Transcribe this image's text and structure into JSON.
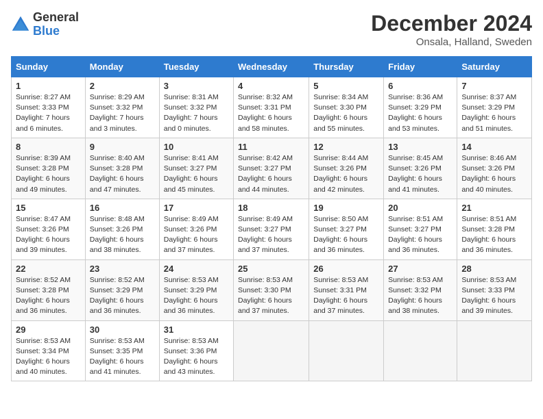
{
  "header": {
    "logo_general": "General",
    "logo_blue": "Blue",
    "month_title": "December 2024",
    "location": "Onsala, Halland, Sweden"
  },
  "days_of_week": [
    "Sunday",
    "Monday",
    "Tuesday",
    "Wednesday",
    "Thursday",
    "Friday",
    "Saturday"
  ],
  "weeks": [
    [
      {
        "day": "1",
        "sunrise": "8:27 AM",
        "sunset": "3:33 PM",
        "daylight": "7 hours and 6 minutes."
      },
      {
        "day": "2",
        "sunrise": "8:29 AM",
        "sunset": "3:32 PM",
        "daylight": "7 hours and 3 minutes."
      },
      {
        "day": "3",
        "sunrise": "8:31 AM",
        "sunset": "3:32 PM",
        "daylight": "7 hours and 0 minutes."
      },
      {
        "day": "4",
        "sunrise": "8:32 AM",
        "sunset": "3:31 PM",
        "daylight": "6 hours and 58 minutes."
      },
      {
        "day": "5",
        "sunrise": "8:34 AM",
        "sunset": "3:30 PM",
        "daylight": "6 hours and 55 minutes."
      },
      {
        "day": "6",
        "sunrise": "8:36 AM",
        "sunset": "3:29 PM",
        "daylight": "6 hours and 53 minutes."
      },
      {
        "day": "7",
        "sunrise": "8:37 AM",
        "sunset": "3:29 PM",
        "daylight": "6 hours and 51 minutes."
      }
    ],
    [
      {
        "day": "8",
        "sunrise": "8:39 AM",
        "sunset": "3:28 PM",
        "daylight": "6 hours and 49 minutes."
      },
      {
        "day": "9",
        "sunrise": "8:40 AM",
        "sunset": "3:28 PM",
        "daylight": "6 hours and 47 minutes."
      },
      {
        "day": "10",
        "sunrise": "8:41 AM",
        "sunset": "3:27 PM",
        "daylight": "6 hours and 45 minutes."
      },
      {
        "day": "11",
        "sunrise": "8:42 AM",
        "sunset": "3:27 PM",
        "daylight": "6 hours and 44 minutes."
      },
      {
        "day": "12",
        "sunrise": "8:44 AM",
        "sunset": "3:26 PM",
        "daylight": "6 hours and 42 minutes."
      },
      {
        "day": "13",
        "sunrise": "8:45 AM",
        "sunset": "3:26 PM",
        "daylight": "6 hours and 41 minutes."
      },
      {
        "day": "14",
        "sunrise": "8:46 AM",
        "sunset": "3:26 PM",
        "daylight": "6 hours and 40 minutes."
      }
    ],
    [
      {
        "day": "15",
        "sunrise": "8:47 AM",
        "sunset": "3:26 PM",
        "daylight": "6 hours and 39 minutes."
      },
      {
        "day": "16",
        "sunrise": "8:48 AM",
        "sunset": "3:26 PM",
        "daylight": "6 hours and 38 minutes."
      },
      {
        "day": "17",
        "sunrise": "8:49 AM",
        "sunset": "3:26 PM",
        "daylight": "6 hours and 37 minutes."
      },
      {
        "day": "18",
        "sunrise": "8:49 AM",
        "sunset": "3:27 PM",
        "daylight": "6 hours and 37 minutes."
      },
      {
        "day": "19",
        "sunrise": "8:50 AM",
        "sunset": "3:27 PM",
        "daylight": "6 hours and 36 minutes."
      },
      {
        "day": "20",
        "sunrise": "8:51 AM",
        "sunset": "3:27 PM",
        "daylight": "6 hours and 36 minutes."
      },
      {
        "day": "21",
        "sunrise": "8:51 AM",
        "sunset": "3:28 PM",
        "daylight": "6 hours and 36 minutes."
      }
    ],
    [
      {
        "day": "22",
        "sunrise": "8:52 AM",
        "sunset": "3:28 PM",
        "daylight": "6 hours and 36 minutes."
      },
      {
        "day": "23",
        "sunrise": "8:52 AM",
        "sunset": "3:29 PM",
        "daylight": "6 hours and 36 minutes."
      },
      {
        "day": "24",
        "sunrise": "8:53 AM",
        "sunset": "3:29 PM",
        "daylight": "6 hours and 36 minutes."
      },
      {
        "day": "25",
        "sunrise": "8:53 AM",
        "sunset": "3:30 PM",
        "daylight": "6 hours and 37 minutes."
      },
      {
        "day": "26",
        "sunrise": "8:53 AM",
        "sunset": "3:31 PM",
        "daylight": "6 hours and 37 minutes."
      },
      {
        "day": "27",
        "sunrise": "8:53 AM",
        "sunset": "3:32 PM",
        "daylight": "6 hours and 38 minutes."
      },
      {
        "day": "28",
        "sunrise": "8:53 AM",
        "sunset": "3:33 PM",
        "daylight": "6 hours and 39 minutes."
      }
    ],
    [
      {
        "day": "29",
        "sunrise": "8:53 AM",
        "sunset": "3:34 PM",
        "daylight": "6 hours and 40 minutes."
      },
      {
        "day": "30",
        "sunrise": "8:53 AM",
        "sunset": "3:35 PM",
        "daylight": "6 hours and 41 minutes."
      },
      {
        "day": "31",
        "sunrise": "8:53 AM",
        "sunset": "3:36 PM",
        "daylight": "6 hours and 43 minutes."
      },
      null,
      null,
      null,
      null
    ]
  ],
  "labels": {
    "sunrise": "Sunrise:",
    "sunset": "Sunset:",
    "daylight": "Daylight hours"
  }
}
